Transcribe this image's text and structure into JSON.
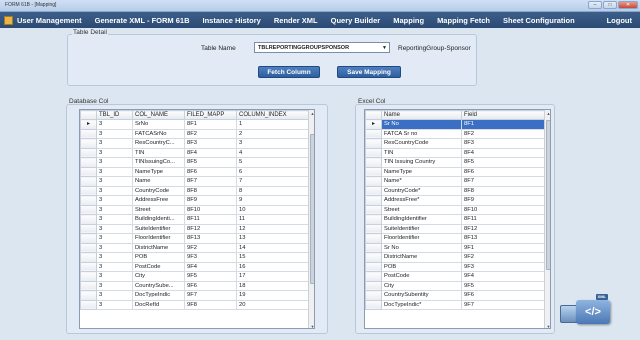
{
  "window": {
    "title": "FORM 61B - [Mapping]"
  },
  "menu": {
    "items": [
      "User Management",
      "Generate XML - FORM 61B",
      "Instance History",
      "Render XML",
      "Query Builder",
      "Mapping",
      "Mapping Fetch",
      "Sheet Configuration"
    ],
    "logout": "Logout"
  },
  "table_detail": {
    "title": "Table Detail",
    "table_name_label": "Table Name",
    "selected_table": "TBLREPORTINGGROUPSPONSOR",
    "table_description": "ReportingGroup-Sponsor",
    "fetch_button": "Fetch Column",
    "save_button": "Save Mapping"
  },
  "database_col": {
    "title": "Database Col",
    "columns": [
      "TBL_ID",
      "COL_NAME",
      "FILED_MAPP",
      "COLUMN_INDEX"
    ],
    "rows": [
      [
        "3",
        "SrNo",
        "8F1",
        "1"
      ],
      [
        "3",
        "FATCASrNo",
        "8F2",
        "2"
      ],
      [
        "3",
        "ResCountryC...",
        "8F3",
        "3"
      ],
      [
        "3",
        "TIN",
        "8F4",
        "4"
      ],
      [
        "3",
        "TINIssuingCo...",
        "8F5",
        "5"
      ],
      [
        "3",
        "NameType",
        "8F6",
        "6"
      ],
      [
        "3",
        "Name",
        "8F7",
        "7"
      ],
      [
        "3",
        "CountryCode",
        "8F8",
        "8"
      ],
      [
        "3",
        "AddressFree",
        "8F9",
        "9"
      ],
      [
        "3",
        "Street",
        "8F10",
        "10"
      ],
      [
        "3",
        "BuildingIdenti...",
        "8F11",
        "11"
      ],
      [
        "3",
        "SuiteIdentifier",
        "8F12",
        "12"
      ],
      [
        "3",
        "FloorIdentifier",
        "8F13",
        "13"
      ],
      [
        "3",
        "DistrictName",
        "9F2",
        "14"
      ],
      [
        "3",
        "POB",
        "9F3",
        "15"
      ],
      [
        "3",
        "PostCode",
        "9F4",
        "16"
      ],
      [
        "3",
        "City",
        "9F5",
        "17"
      ],
      [
        "3",
        "CountrySube...",
        "9F6",
        "18"
      ],
      [
        "3",
        "DocTypeIndic",
        "9F7",
        "19"
      ],
      [
        "3",
        "DocRefId",
        "9F8",
        "20"
      ]
    ]
  },
  "excel_col": {
    "title": "Excel Col",
    "columns": [
      "Name",
      "Field"
    ],
    "rows": [
      [
        "Sr No",
        "8F1"
      ],
      [
        "FATCA Sr no",
        "8F2"
      ],
      [
        "ResCountryCode",
        "8F3"
      ],
      [
        "TIN",
        "8F4"
      ],
      [
        "TIN Issuing Country",
        "8F5"
      ],
      [
        "NameType",
        "8F6"
      ],
      [
        "Name*",
        "8F7"
      ],
      [
        "CountryCode*",
        "8F8"
      ],
      [
        "AddressFree*",
        "8F9"
      ],
      [
        "Street",
        "8F10"
      ],
      [
        "BuildingIdentifier",
        "8F11"
      ],
      [
        "SuiteIdentifier",
        "8F12"
      ],
      [
        "FloorIdentifier",
        "8F13"
      ],
      [
        "Sr No",
        "9F1"
      ],
      [
        "DistrictName",
        "9F2"
      ],
      [
        "POB",
        "9F3"
      ],
      [
        "PostCode",
        "9F4"
      ],
      [
        "City",
        "9F5"
      ],
      [
        "CountrySubentity",
        "9F6"
      ],
      [
        "DocTypeIndic*",
        "9F7"
      ]
    ]
  },
  "badge": {
    "label": "</>",
    "tag": "XML"
  },
  "colors": {
    "menubar": "#2b4a73",
    "selection": "#3b6fc4",
    "button": "#2d5f9e"
  }
}
